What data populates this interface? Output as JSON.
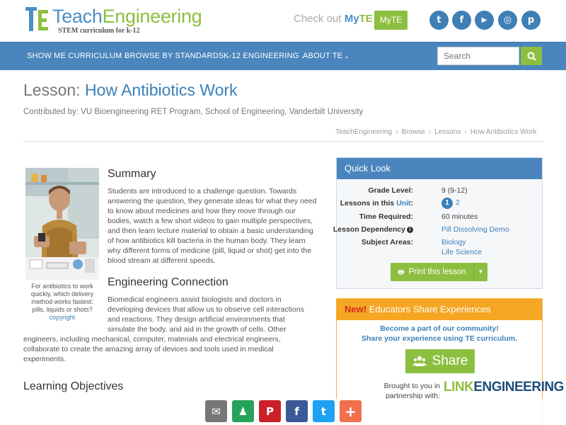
{
  "header": {
    "logo_teach": "Teach",
    "logo_engineering": "Engineering",
    "logo_tagline": "STEM curriculum for k-12",
    "checkout_text": "Check out",
    "checkout_my": "My",
    "checkout_te": "TE",
    "myte_button": "MyTE",
    "social": [
      {
        "icon": "twitter-icon",
        "glyph": "t"
      },
      {
        "icon": "facebook-icon",
        "glyph": "f"
      },
      {
        "icon": "youtube-icon",
        "glyph": "▶"
      },
      {
        "icon": "instagram-icon",
        "glyph": "◎"
      },
      {
        "icon": "pinterest-icon",
        "glyph": "p"
      }
    ]
  },
  "nav": {
    "items": [
      {
        "label": "SHOW ME CURRICULUM"
      },
      {
        "label": "BROWSE BY STANDARDS"
      },
      {
        "label": "K-12 ENGINEERING"
      },
      {
        "label": "ABOUT TE"
      }
    ],
    "caret": "⌄",
    "search_placeholder": "Search"
  },
  "page": {
    "title_prefix": "Lesson:",
    "title_name": "How Antibiotics Work",
    "contributed": "Contributed by: VU Bioengineering RET Program, School of Engineering, Vanderbilt University",
    "breadcrumbs": [
      "TeachEngineering",
      "Browse",
      "Lessons",
      "How Antibiotics Work"
    ],
    "breadcrumb_sep": "›"
  },
  "photo": {
    "caption": "For antibiotics to work quickly, which delivery method works fastest: pills, liquids or shots?",
    "caption_link": "copyright"
  },
  "summary": {
    "heading": "Summary",
    "text": "Students are introduced to a challenge question. Towards answering the question, they generate ideas for what they need to know about medicines and how they move through our bodies, watch a few short videos to gain multiple perspectives, and then learn lecture material to obtain a basic understanding of how antibiotics kill bacteria in the human body. They learn why different forms of medicine (pill, liquid or shot) get into the blood stream at different speeds."
  },
  "engineering": {
    "heading": "Engineering Connection",
    "lines": [
      "Biomedical engineers assist biologists and doctors in",
      "developing devices that allow us to observe cell interactions",
      "and reactions. They design artificial environments that",
      "simulate the body, and aid in the growth of cells. Other",
      "engineers, including mechanical, computer, materials and electrical engineers,",
      "collaborate to create the amazing array of devices and tools used in medical",
      "experiments."
    ]
  },
  "learning": {
    "heading": "Learning Objectives"
  },
  "quicklook": {
    "heading": "Quick Look",
    "grade_label": "Grade Level:",
    "grade_value": "9 (9-12)",
    "lessons_label_pre": "Lessons in this",
    "lessons_label_unit": "Unit",
    "lessons_label_post": ":",
    "lesson_current": "1",
    "lesson_other": "2",
    "time_label": "Time Required:",
    "time_value": "60 minutes",
    "dependency_label": "Lesson Dependency",
    "dependency_value": "Pill Dissolving Demo",
    "subject_label": "Subject Areas:",
    "subjects": [
      "Biology",
      "Life Science"
    ],
    "print_button": "Print this lesson"
  },
  "educators": {
    "new": "New!",
    "heading": "Educators Share Experiences",
    "line1": "Become a part of our community!",
    "line2": "Share your experience using TE curriculum.",
    "share_button": "Share",
    "brought_line1": "Brought to you in",
    "brought_line2": "partnership with:",
    "partner_link": "LINK",
    "partner_rest": "ENGINEERING"
  },
  "sharebar": [
    {
      "icon": "email-icon",
      "glyph": "✉",
      "color": "#777777"
    },
    {
      "icon": "google-classroom-icon",
      "glyph": "♟",
      "color": "#25a35a"
    },
    {
      "icon": "pinterest-icon",
      "glyph": "P",
      "color": "#cb2027"
    },
    {
      "icon": "facebook-icon",
      "glyph": "f",
      "color": "#3b5998"
    },
    {
      "icon": "twitter-icon",
      "glyph": "t",
      "color": "#1da1f2"
    },
    {
      "icon": "more-share-icon",
      "glyph": "+",
      "color": "#f26f4e"
    }
  ],
  "colors": {
    "brand_blue": "#4a86bd",
    "brand_green": "#8cbf3f",
    "orange": "#f5a623"
  }
}
